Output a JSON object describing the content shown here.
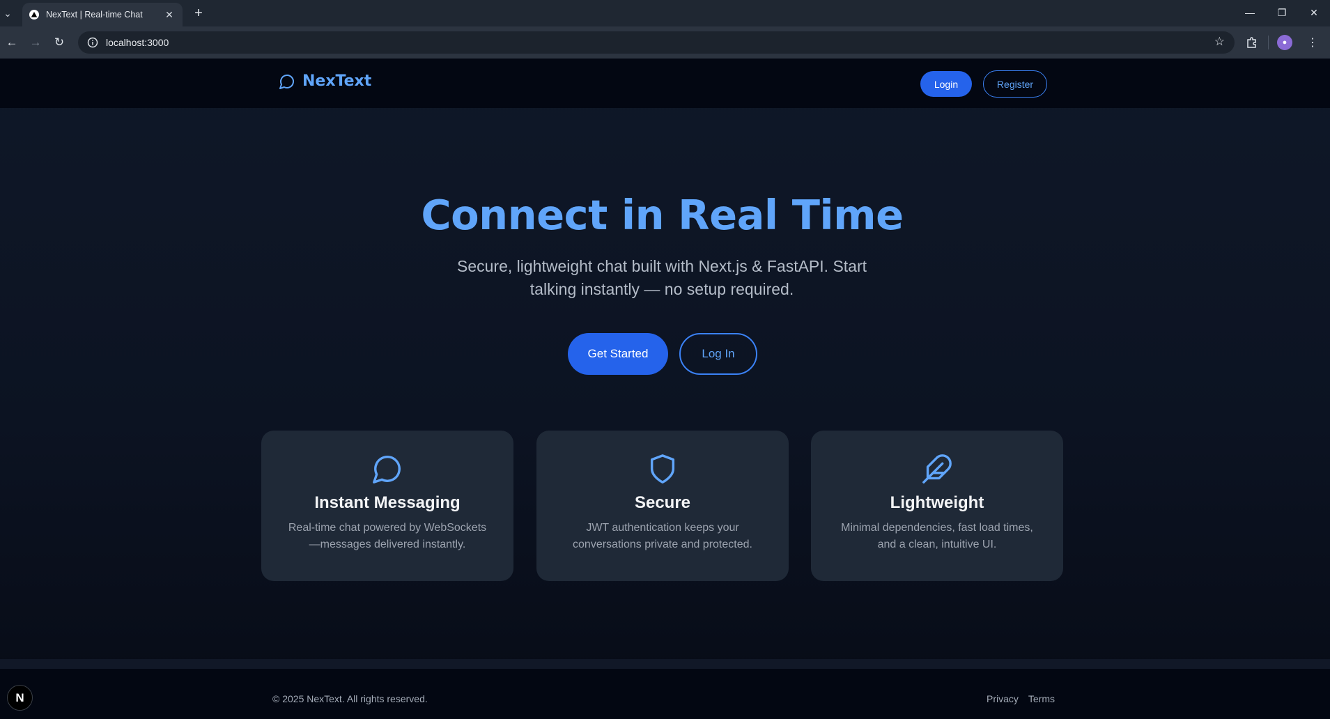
{
  "browser": {
    "tab_title": "NexText | Real-time Chat",
    "tab_close": "✕",
    "new_tab": "+",
    "url": "localhost:3000",
    "window_controls": {
      "minimize": "—",
      "restore": "❐",
      "close": "✕"
    }
  },
  "header": {
    "brand": "NexText",
    "login_label": "Login",
    "register_label": "Register"
  },
  "hero": {
    "title": "Connect in Real Time",
    "subtitle": "Secure, lightweight chat built with Next.js & FastAPI. Start talking instantly — no setup required.",
    "primary_cta": "Get Started",
    "secondary_cta": "Log In"
  },
  "features": [
    {
      "icon": "message-circle-icon",
      "title": "Instant Messaging",
      "description": "Real-time chat powered by WebSockets—messages delivered instantly."
    },
    {
      "icon": "shield-icon",
      "title": "Secure",
      "description": "JWT authentication keeps your conversations private and protected."
    },
    {
      "icon": "feather-icon",
      "title": "Lightweight",
      "description": "Minimal dependencies, fast load times, and a clean, intuitive UI."
    }
  ],
  "footer": {
    "copyright": "© 2025 NexText. All rights reserved.",
    "links": [
      "Privacy",
      "Terms"
    ]
  },
  "next_badge": "N",
  "colors": {
    "accent": "#60a5fa",
    "button": "#2563eb",
    "card": "#1f2937",
    "header": "#030712"
  }
}
